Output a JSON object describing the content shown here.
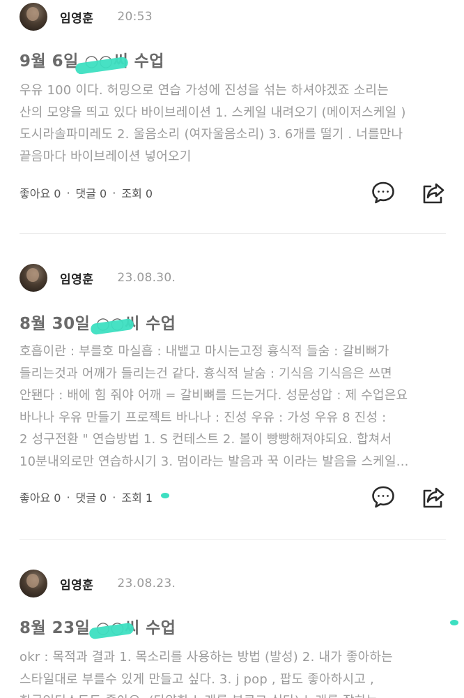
{
  "accent_color": "#3ddfc1",
  "posts": [
    {
      "author": "임영훈",
      "timestamp": "20:53",
      "title": "9월 6일 ○○씨 수업",
      "body_lines": [
        "우유 100 이다. 허밍으로 연습 가성에 진성을 섞는 하셔야겠죠 소리는",
        "산의 모양을 띄고 있다 바이브레이션 1. 스케일 내려오기 (메이저스케일 )",
        "도시라솔파미레도 2. 울음소리 (여자울음소리) 3. 6개를 떨기 . 너를만나",
        "끝음마다 바이브레이션 넣어오기"
      ],
      "likes_label": "좋아요 0",
      "comments_label": "댓글 0",
      "views_label": "조회 0"
    },
    {
      "author": "임영훈",
      "timestamp": "23.08.30.",
      "title": "8월 30일 ○○씨 수업",
      "body_lines": [
        "호흡이란 : 부를호 마실흡 : 내뱉고 마시는고정 흉식적 들숨 : 갈비뼈가",
        "들리는것과 어깨가 들리는건 같다. 흉식적 날숨 : 기식음 기식음은 쓰면",
        "안됀다 : 배에 힘 줘야 어깨 = 갈비뼈를 드는거다. 성문성압 : 제 수업은요",
        "바나나 우유 만들기 프로젝트 바나나 : 진성 우유 : 가성 우유 8 진성 :",
        "2 성구전환 \" 연습방법 1. S 컨테스트 2. 볼이 빵빵해져야되요. 합쳐서",
        "10분내외로만 연습하시기 3. 멈이라는 발음과 꾹 이라는 발음을 스케일..."
      ],
      "likes_label": "좋아요 0",
      "comments_label": "댓글 0",
      "views_label": "조회 1"
    },
    {
      "author": "임영훈",
      "timestamp": "23.08.23.",
      "title": "8월 23일 ○○씨 수업",
      "body_lines": [
        "okr : 목적과 결과 1. 목소리를 사용하는 방법 (발성) 2. 내가 좋아하는",
        "스타일대로 부를수 있게 만들고 싶다. 3. j pop , 팝도 좋아하시고 ,",
        "한국인디스도도 좋아요. (다양한 노래를 부르고 싶다) 노래를 잘하는"
      ]
    }
  ],
  "icons": {
    "comment": "comment-bubble-icon",
    "share": "share-icon"
  }
}
